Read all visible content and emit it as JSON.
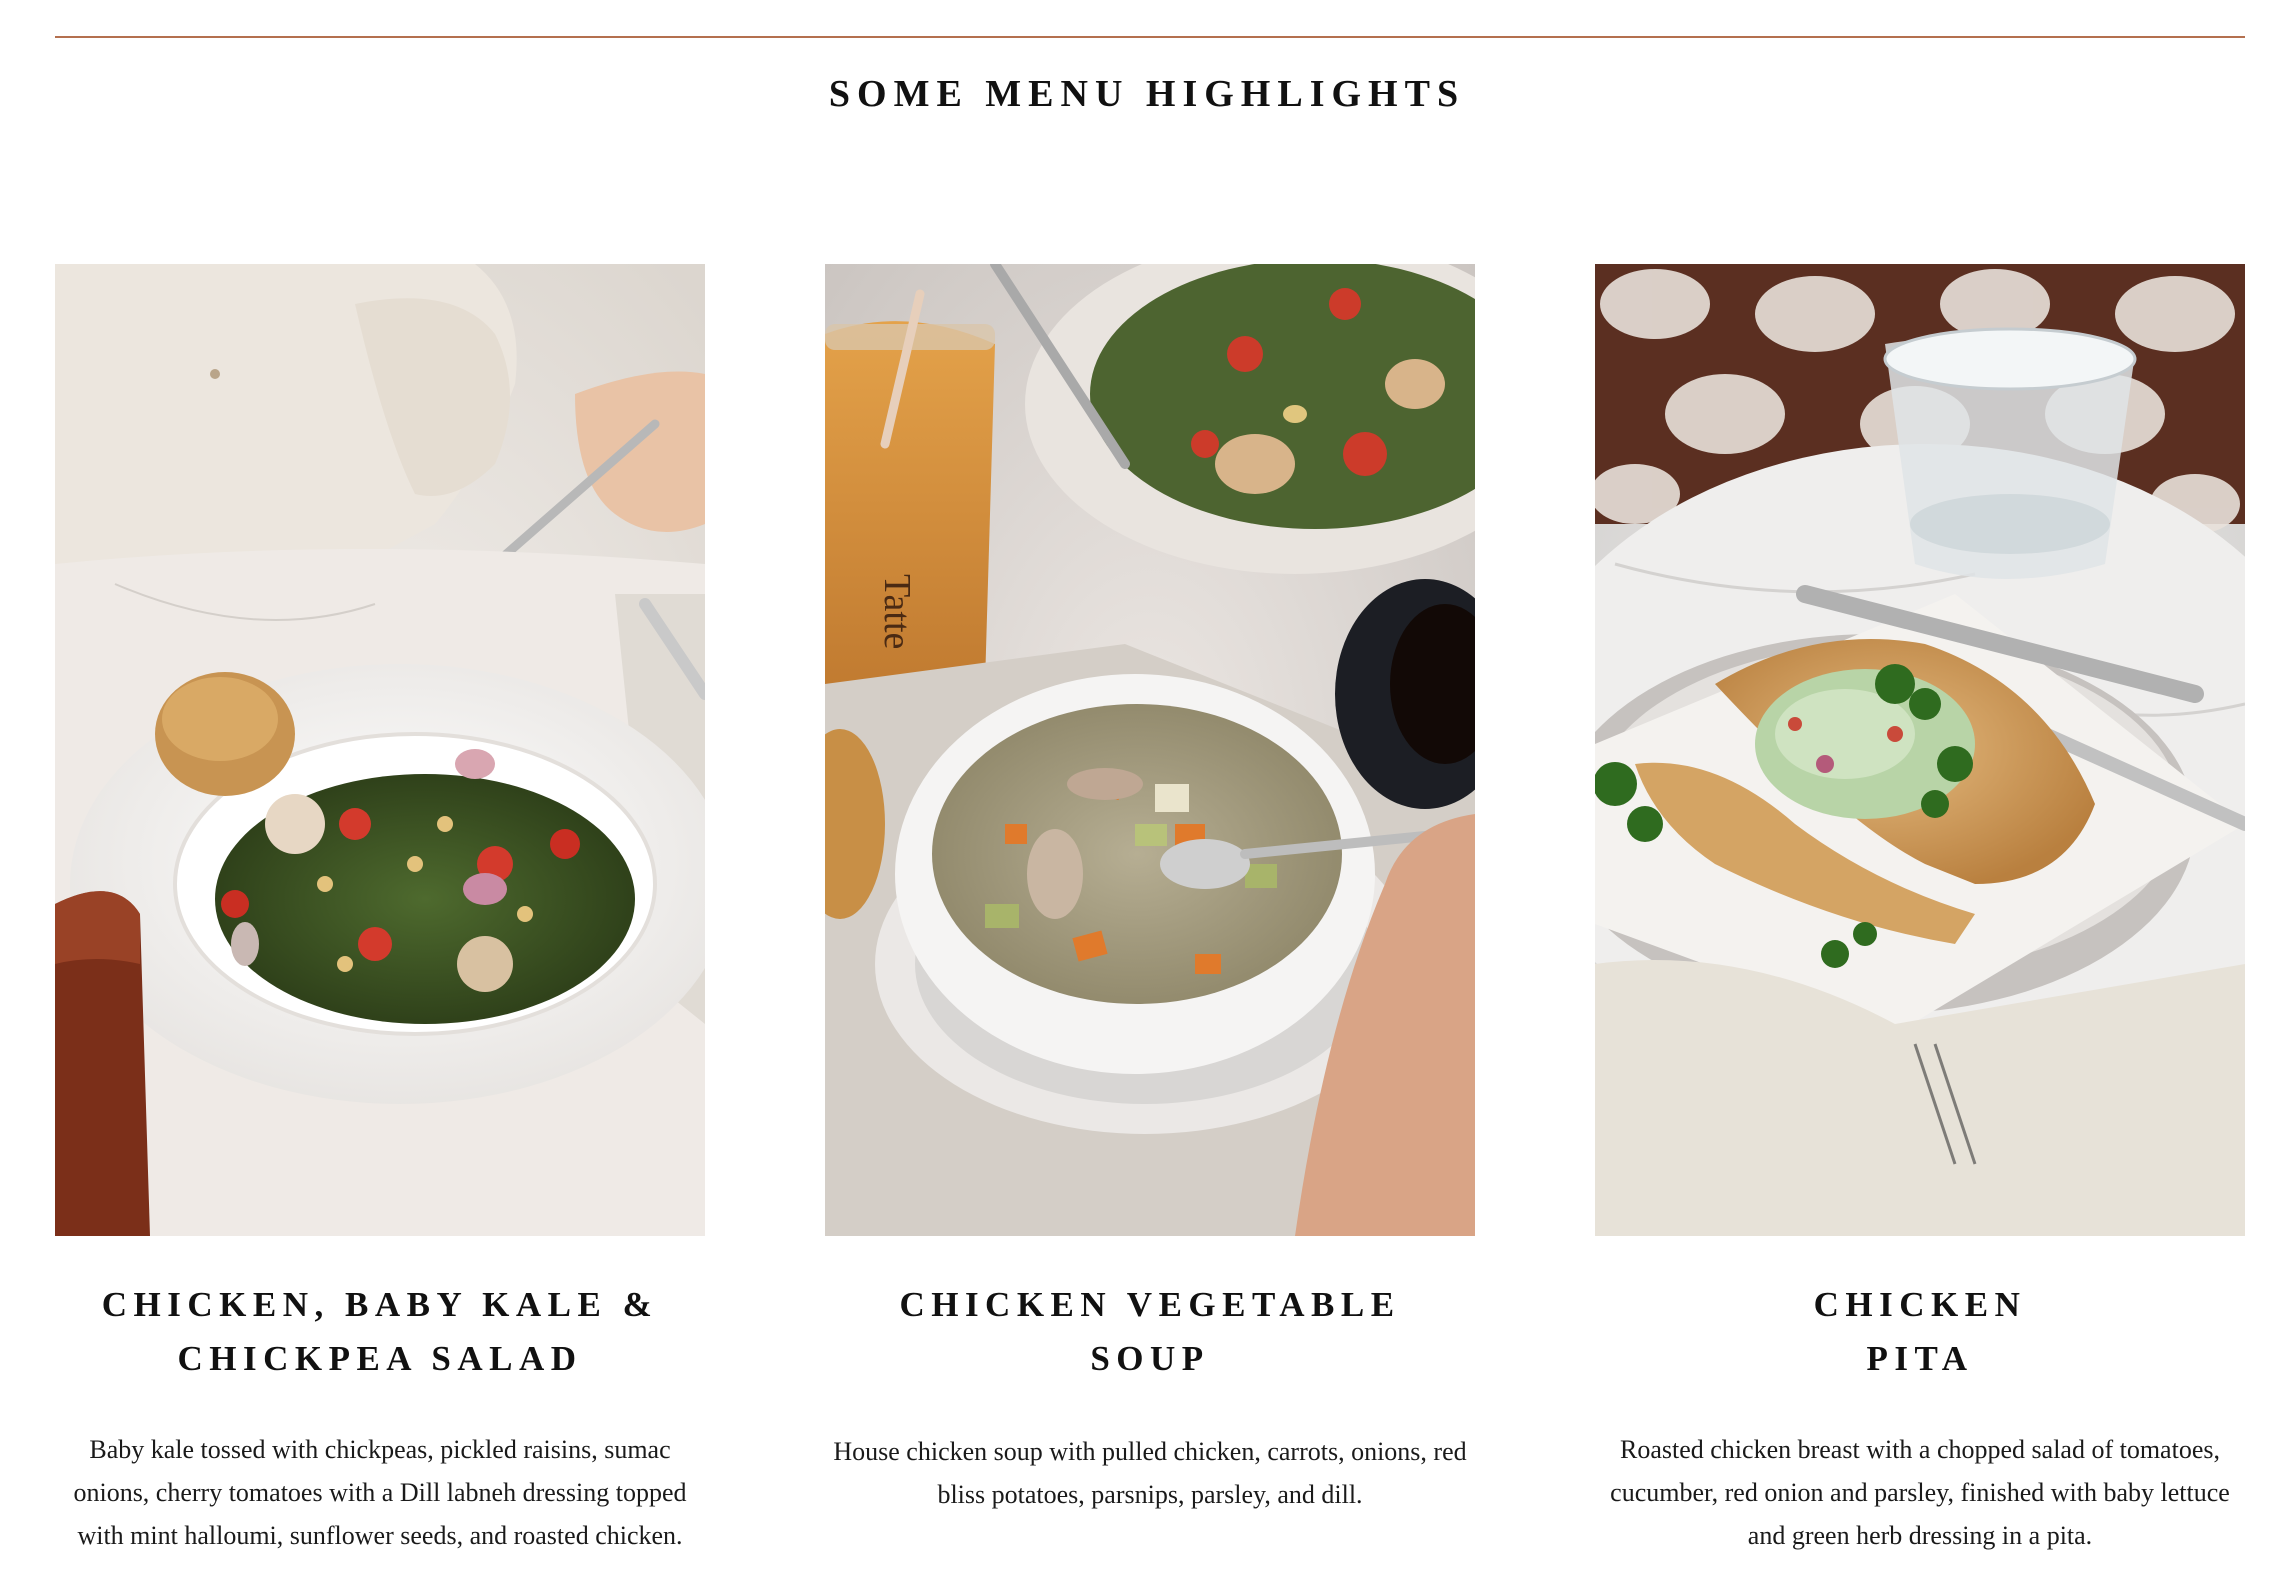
{
  "section": {
    "title": "SOME MENU HIGHLIGHTS"
  },
  "colors": {
    "rule": "#b4704f",
    "text": "#111111"
  },
  "cards": [
    {
      "photo_label": "",
      "title_lines": [
        "CHICKEN, BABY KALE &",
        "CHICKPEA SALAD"
      ],
      "description": "Baby kale tossed with chickpeas, pickled raisins, sumac onions, cherry tomatoes with a Dill labneh dressing topped with mint halloumi, sunflower seeds, and roasted chicken."
    },
    {
      "photo_label": "Tatte",
      "title_lines": [
        "CHICKEN VEGETABLE",
        "SOUP"
      ],
      "description": "House chicken soup with pulled chicken, carrots, onions, red bliss potatoes, parsnips, parsley, and dill."
    },
    {
      "photo_label": "",
      "title_lines": [
        "CHICKEN",
        "PITA"
      ],
      "description": "Roasted chicken breast with a chopped salad of tomatoes, cucumber, red onion and parsley, finished with baby lettuce and green herb dressing in a pita."
    }
  ]
}
